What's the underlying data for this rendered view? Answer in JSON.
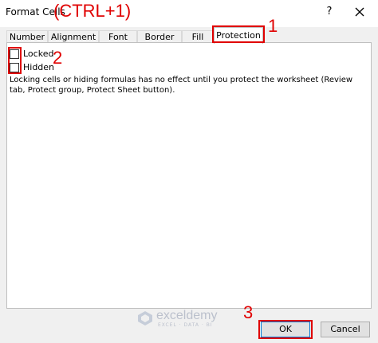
{
  "dialog": {
    "title": "Format Cells",
    "help": "?"
  },
  "annotations": {
    "shortcut": "(CTRL+1)",
    "step1": "1",
    "step2": "2",
    "step3": "3"
  },
  "tabs": [
    {
      "label": "Number"
    },
    {
      "label": "Alignment"
    },
    {
      "label": "Font"
    },
    {
      "label": "Border"
    },
    {
      "label": "Fill"
    },
    {
      "label": "Protection"
    }
  ],
  "protection": {
    "locked_label": "Locked",
    "hidden_label": "Hidden",
    "info": "Locking cells or hiding formulas has no effect until you protect the worksheet (Review tab, Protect group, Protect Sheet button)."
  },
  "watermark": {
    "name": "exceldemy",
    "tagline": "EXCEL · DATA · BI"
  },
  "buttons": {
    "ok": "OK",
    "cancel": "Cancel"
  },
  "colors": {
    "annotation": "#e00000",
    "accent_border": "#0078d7"
  }
}
